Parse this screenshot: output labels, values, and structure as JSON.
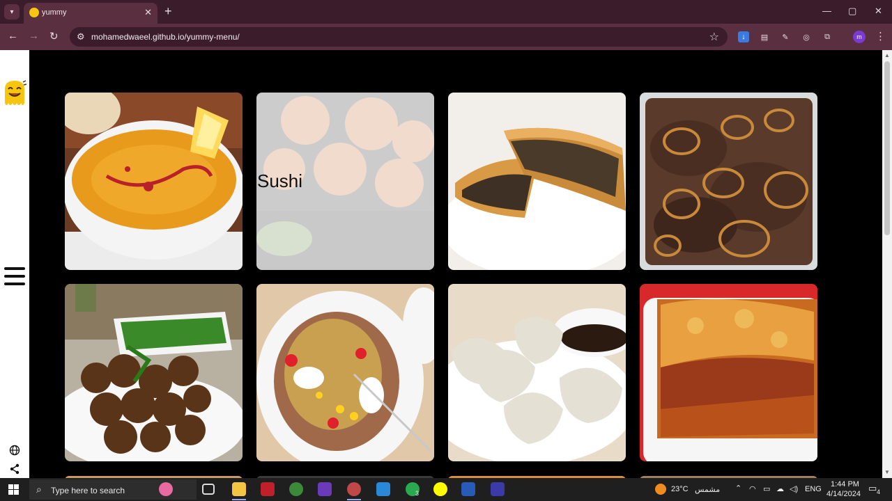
{
  "browser": {
    "tab_title": "yummy",
    "url": "mohamedwaeel.github.io/yummy-menu/",
    "new_tab_label": "+",
    "close_tab_label": "✕",
    "profile_initial": "m"
  },
  "main": {
    "cards": [
      {
        "name": "soup",
        "title": ""
      },
      {
        "name": "sushi",
        "title": "Sushi"
      },
      {
        "name": "meat-pie",
        "title": ""
      },
      {
        "name": "liver-onions",
        "title": ""
      },
      {
        "name": "falafel",
        "title": ""
      },
      {
        "name": "stuffed-potato",
        "title": ""
      },
      {
        "name": "dumplings",
        "title": ""
      },
      {
        "name": "lasagna",
        "title": ""
      }
    ]
  },
  "taskbar": {
    "search_placeholder": "Type here to search",
    "weather_temp": "23°C",
    "weather_desc": "مشمس",
    "language": "ENG",
    "time": "1:44 PM",
    "date": "4/14/2024",
    "whatsapp_badge": "3",
    "notification_count": "4"
  },
  "colors": {
    "tabstrip": "#3b1c2a",
    "toolbar": "#5a2f3f",
    "page_background": "#000000",
    "sidebar": "#ffffff",
    "overlay": "#f0f0f0"
  },
  "icons": {
    "menu": "hamburger-icon",
    "globe": "globe-icon",
    "share": "share-icon",
    "logo": "smiley-logo"
  }
}
